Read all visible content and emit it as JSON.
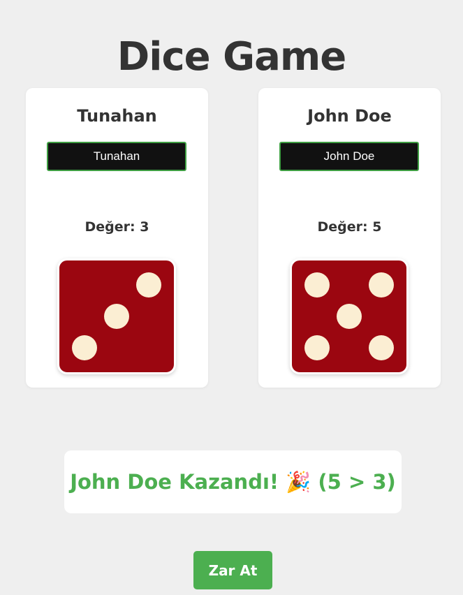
{
  "title": "Dice Game",
  "players": [
    {
      "name": "Tunahan",
      "input_value": "Tunahan",
      "value_label": "Değer: 3",
      "die_value": 3
    },
    {
      "name": "John Doe",
      "input_value": "John Doe",
      "value_label": "Değer: 5",
      "die_value": 5
    }
  ],
  "result": {
    "text": "John Doe Kazandı! 🎉 (5 > 3)"
  },
  "roll_button": {
    "label": "Zar At"
  },
  "colors": {
    "die": "#9b0610",
    "pip": "#fbeed3",
    "accent": "#4caf50",
    "input_border": "#3f9e43"
  }
}
